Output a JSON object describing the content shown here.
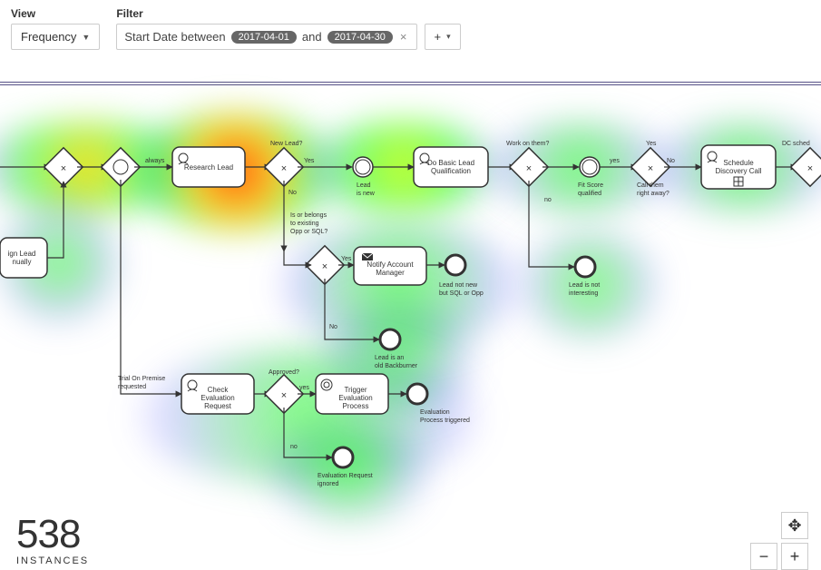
{
  "toolbar": {
    "view_label": "View",
    "filter_label": "Filter",
    "view_button": "Frequency",
    "filter_text_prefix": "Start Date between",
    "filter_text_joiner": "and",
    "filter_date_from": "2017-04-01",
    "filter_date_to": "2017-04-30",
    "add_filter": "+"
  },
  "stats": {
    "count": "538",
    "unit": "INSTANCES"
  },
  "zoom": {
    "fit": "✥",
    "out": "−",
    "in": "+"
  },
  "nodes": {
    "research_lead": "Research Lead",
    "assign_lead": "ign Lead\nnually",
    "do_basic": "Do Basic Lead\nQualification",
    "notify_acct": "Notify Account\nManager",
    "check_eval": "Check\nEvaluation\nRequest",
    "trigger_eval": "Trigger\nEvaluation\nProcess",
    "sched_call": "Schedule\nDiscovery Call"
  },
  "gateways": {
    "new_lead": "New Lead?",
    "belongs": "Is or belongs\nto existing\nOpp or SQL?",
    "work_on": "Work on them?",
    "call_right": "Call them\nright away?",
    "approved": "Approved?",
    "dc_sched": "DC sched"
  },
  "events": {
    "lead_new": "Lead\nis new",
    "fit_score": "Fit Score\nqualified",
    "lead_not_new": "Lead not new\nbut SQL or Opp",
    "lead_bb": "Lead is an\nold Backburner",
    "not_interesting": "Lead is not\ninteresting",
    "eval_trig": "Evaluation\nProcess triggered",
    "eval_ign": "Evaluation Request\nignored",
    "trial_req": "Trial On Premise\nrequested"
  },
  "edge_labels": {
    "always": "always",
    "yes": "Yes",
    "yes_lc": "yes",
    "no": "No",
    "no_lc": "no"
  }
}
